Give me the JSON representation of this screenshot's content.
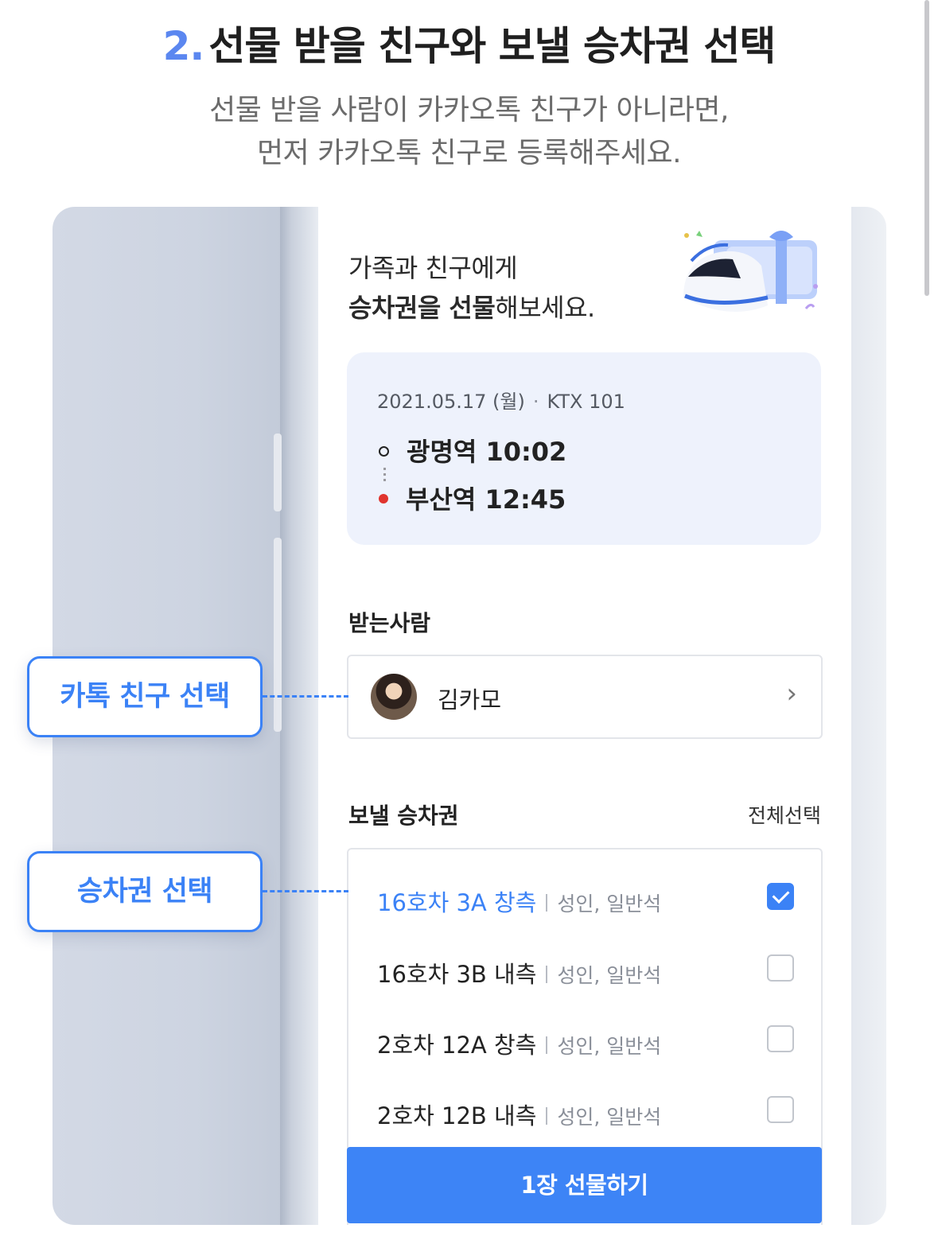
{
  "header": {
    "step_number": "2.",
    "title": "선물 받을 친구와 보낼 승차권 선택",
    "description_line1": "선물 받을 사람이 카카오톡 친구가 아니라면,",
    "description_line2": "먼저 카카오톡 친구로 등록해주세요."
  },
  "screen": {
    "promo_line1": "가족과 친구에게",
    "promo_bold": "승차권을 선물",
    "promo_rest": "해보세요.",
    "trip": {
      "date": "2021.05.17 (월)",
      "separator": "·",
      "train": "KTX 101",
      "departure": "광명역 10:02",
      "arrival": "부산역 12:45"
    },
    "recipient": {
      "section_label": "받는사람",
      "name": "김카모",
      "chevron": "›"
    },
    "tickets": {
      "section_label": "보낼 승차권",
      "select_all": "전체선택",
      "items": [
        {
          "seat": "16호차 3A 창측",
          "detail": "성인, 일반석",
          "checked": true
        },
        {
          "seat": "16호차 3B 내측",
          "detail": "성인, 일반석",
          "checked": false
        },
        {
          "seat": "2호차 12A 창측",
          "detail": "성인, 일반석",
          "checked": false
        },
        {
          "seat": "2호차 12B 내측",
          "detail": "성인, 일반석",
          "checked": false
        }
      ]
    },
    "gift_button": "1장 선물하기"
  },
  "callouts": {
    "friend_select": "카톡 친구 선택",
    "ticket_select": "승차권 선택"
  },
  "colors": {
    "accent": "#3b82f6",
    "step_number": "#5b87f0",
    "card_bg": "#eef2fc",
    "arrival_marker": "#e0342e"
  }
}
